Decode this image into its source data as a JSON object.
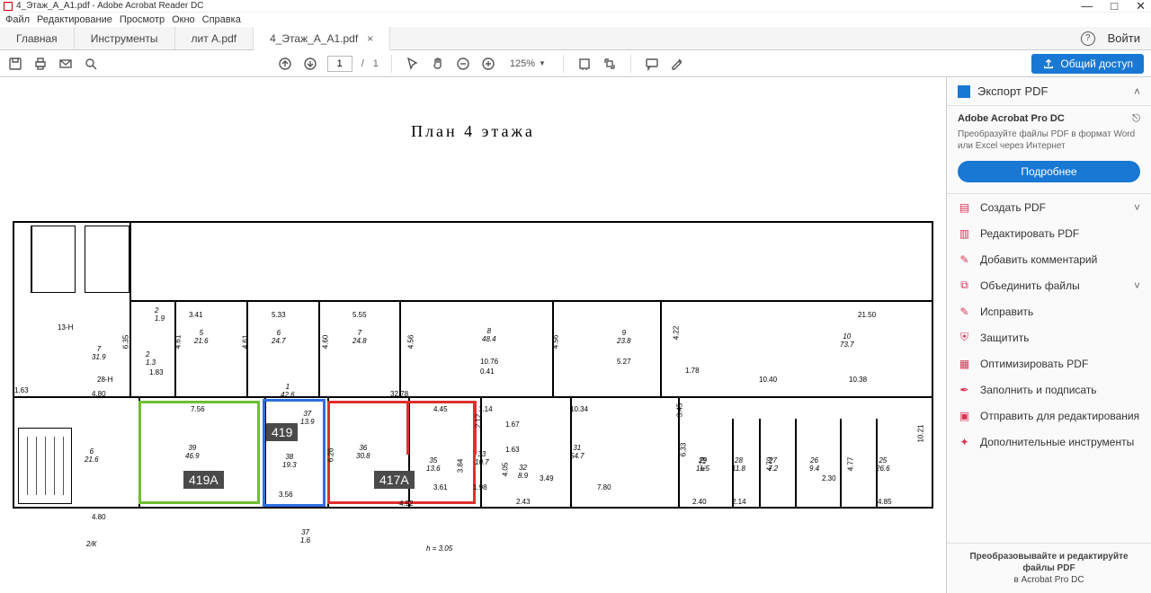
{
  "titlebar": {
    "text": "4_Этаж_А_А1.pdf - Adobe Acrobat Reader DC"
  },
  "menu": {
    "file": "Файл",
    "edit": "Редактирование",
    "view": "Просмотр",
    "window": "Окно",
    "help": "Справка"
  },
  "tabs": {
    "home": "Главная",
    "tools": "Инструменты",
    "doc1": "лит A.pdf",
    "doc2": "4_Этаж_А_А1.pdf",
    "login": "Войти"
  },
  "toolbar": {
    "page_current": "1",
    "page_sep": "/",
    "page_total": "1",
    "zoom": "125%",
    "share": "Общий доступ"
  },
  "rightpanel": {
    "export_title": "Экспорт PDF",
    "pro_title": "Adobe Acrobat Pro DC",
    "pro_sub": "Преобразуйте файлы PDF в формат Word или Excel через Интернет",
    "pro_btn": "Подробнее",
    "items": {
      "create": "Создать PDF",
      "edit": "Редактировать PDF",
      "comment": "Добавить комментарий",
      "combine": "Объединить файлы",
      "fix": "Исправить",
      "protect": "Защитить",
      "optimize": "Оптимизировать PDF",
      "fill": "Заполнить и подписать",
      "send": "Отправить для редактирования",
      "more": "Дополнительные инструменты"
    },
    "footer_l1": "Преобразовывайте и редактируйте файлы PDF",
    "footer_l2": "в Acrobat Pro DC"
  },
  "plan": {
    "title": "План 4 этажа",
    "rooms": {
      "r419a": "419А",
      "r419": "419",
      "r417a": "417А"
    },
    "labels": {
      "d341": "3.41",
      "d533": "5.33",
      "d555": "5.55",
      "d635": "6.35",
      "d461": "4.61",
      "d460": "4.60",
      "d456a": "4.56",
      "d456b": "4.56",
      "d422": "4.22",
      "d2150": "21.50",
      "r7_319": "7\n31.9",
      "r2_19": "2\n1.9",
      "r5_216": "5\n21.6",
      "r6_247": "6\n24.7",
      "r7_248": "7\n24.8",
      "r8_484": "8\n48.4",
      "r9_238": "9\n23.8",
      "r10_737": "10\n73.7",
      "d1076": "10.76",
      "d527": "5.27",
      "d178": "1.78",
      "d1040": "10.40",
      "d1038": "10.38",
      "d163": "1.63",
      "d480a": "4.80",
      "d480b": "4.80",
      "d756": "7.56",
      "r39_469": "39\n46.9",
      "r1_426": "1\n42.6",
      "d3278": "32.78",
      "d445": "4.45",
      "d114": "1.14",
      "d1034": "10.34",
      "r37_139": "37\n13.9",
      "r36_308": "36\n30.8",
      "r38_193": "38\n19.3",
      "d356": "3.56",
      "r35_136": "35\n13.6",
      "d492": "4.92",
      "d361": "3.61",
      "r33_107": "33\n10.7",
      "d198": "1.98",
      "r6_216": "6\n21.6",
      "r32_89": "32\n8.9",
      "d349": "3.49",
      "d243": "2.43",
      "r31_547": "31\n54.7",
      "d780": "7.80",
      "d633": "6.33",
      "d240": "2.40",
      "r29_115": "29\n11.5",
      "r28_118": "28\n11.8",
      "d214": "2.14",
      "r27_72": "27\n7.2",
      "r26_94": "26\n9.4",
      "d230": "2.30",
      "r25_266": "25\n26.6",
      "d485": "4.85",
      "d13H": "13-Н",
      "d28H": "28-Н",
      "r2_13": "2\n1.3",
      "d183": "1.83",
      "d041": "0.41",
      "d479a": "4.79",
      "d479b": "4.79",
      "d477": "4.77",
      "d345": "3.45",
      "d1021": "10.21",
      "d2K": "2/К",
      "d37_16": "37\n1.6",
      "dh305": "h = 3.05",
      "d167a": "1.67",
      "d163b": "1.63",
      "d405": "4.05",
      "d384": "3.84",
      "d626": "6.26",
      "d212": "2.12"
    }
  }
}
